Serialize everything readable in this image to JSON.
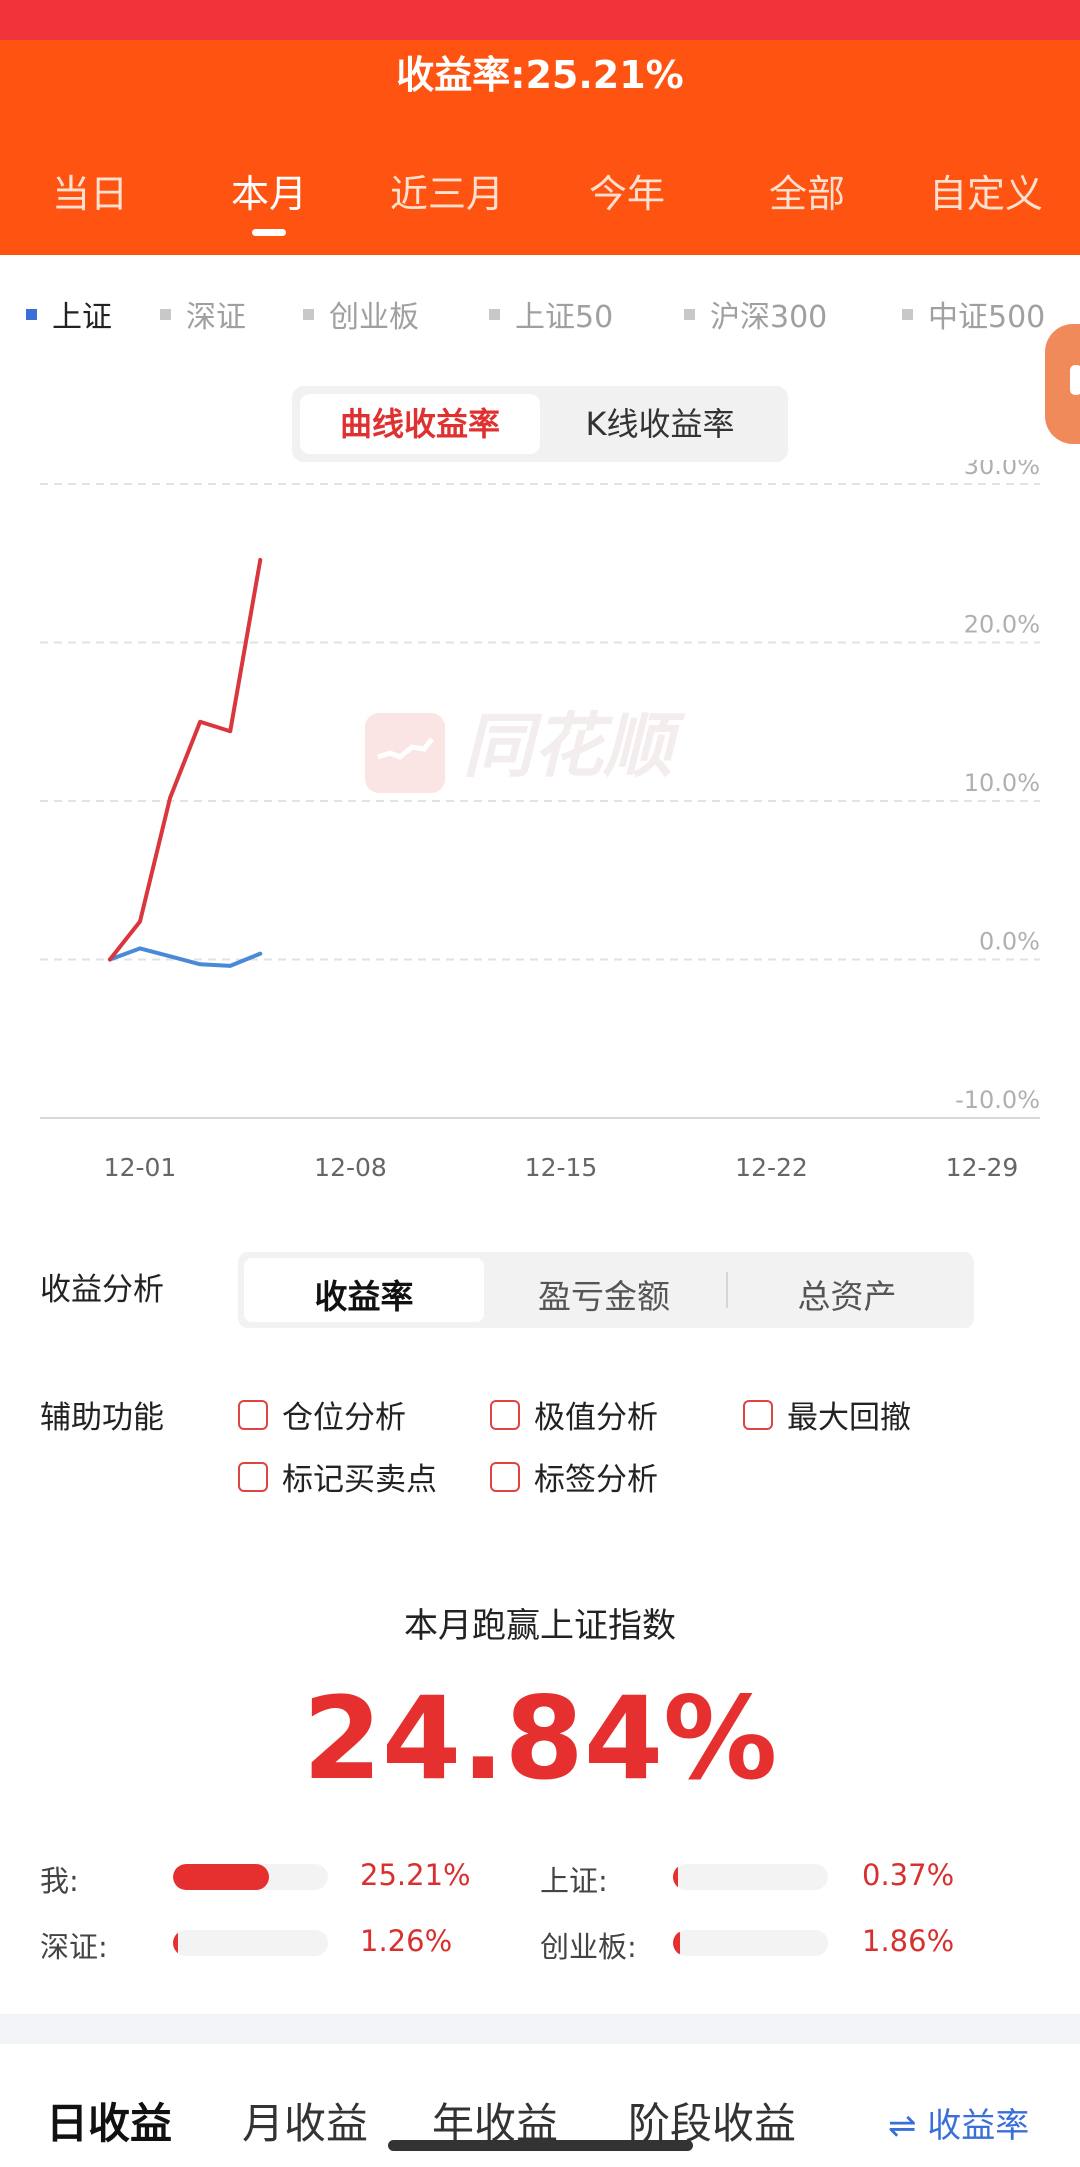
{
  "header": {
    "return_rate": "收益率:25.21%",
    "period_tabs": [
      "当日",
      "本月",
      "近三月",
      "今年",
      "全部",
      "自定义"
    ],
    "active_period": "本月"
  },
  "index_legend": [
    {
      "label": "上证",
      "active": true
    },
    {
      "label": "深证",
      "active": false
    },
    {
      "label": "创业板",
      "active": false
    },
    {
      "label": "上证50",
      "active": false
    },
    {
      "label": "沪深300",
      "active": false
    },
    {
      "label": "中证500",
      "active": false
    }
  ],
  "chart_switch": {
    "curve": "曲线收益率",
    "kline": "K线收益率",
    "active": "curve"
  },
  "watermark": "同花顺",
  "chart_data": {
    "type": "line",
    "x_tick_labels": [
      "12-01",
      "12-08",
      "12-15",
      "12-22",
      "12-29"
    ],
    "y_tick_labels": [
      "30.0%",
      "20.0%",
      "10.0%",
      "0.0%",
      "-10.0%"
    ],
    "ylim": [
      -10,
      30
    ],
    "x_day_range": [
      1,
      29
    ],
    "grid": true,
    "series": [
      {
        "name": "我",
        "color": "#d9363e",
        "x": [
          "11-30",
          "12-01",
          "12-02",
          "12-03",
          "12-04",
          "12-05"
        ],
        "values": [
          0,
          2.4,
          10.2,
          15.0,
          14.4,
          25.21
        ]
      },
      {
        "name": "上证",
        "color": "#4a88d8",
        "x": [
          "11-30",
          "12-01",
          "12-02",
          "12-03",
          "12-04",
          "12-05"
        ],
        "values": [
          0,
          0.7,
          0.2,
          -0.3,
          -0.4,
          0.37
        ]
      }
    ]
  },
  "analysis": {
    "label": "收益分析",
    "segments": [
      "收益率",
      "盈亏金额",
      "总资产"
    ],
    "active": "收益率"
  },
  "aux": {
    "label": "辅助功能",
    "options": [
      "仓位分析",
      "极值分析",
      "最大回撤",
      "标记买卖点",
      "标签分析"
    ]
  },
  "summary": {
    "title": "本月跑赢上证指数",
    "value": "24.84%",
    "items": [
      {
        "name": "我:",
        "value": "25.21%",
        "pct": 25.21
      },
      {
        "name": "上证:",
        "value": "0.37%",
        "pct": 0.37
      },
      {
        "name": "深证:",
        "value": "1.26%",
        "pct": 1.26
      },
      {
        "name": "创业板:",
        "value": "1.86%",
        "pct": 1.86
      }
    ]
  },
  "bottom_tabs": [
    "日收益",
    "月收益",
    "年收益",
    "阶段收益"
  ],
  "rate_toggle": "⇌ 收益率"
}
